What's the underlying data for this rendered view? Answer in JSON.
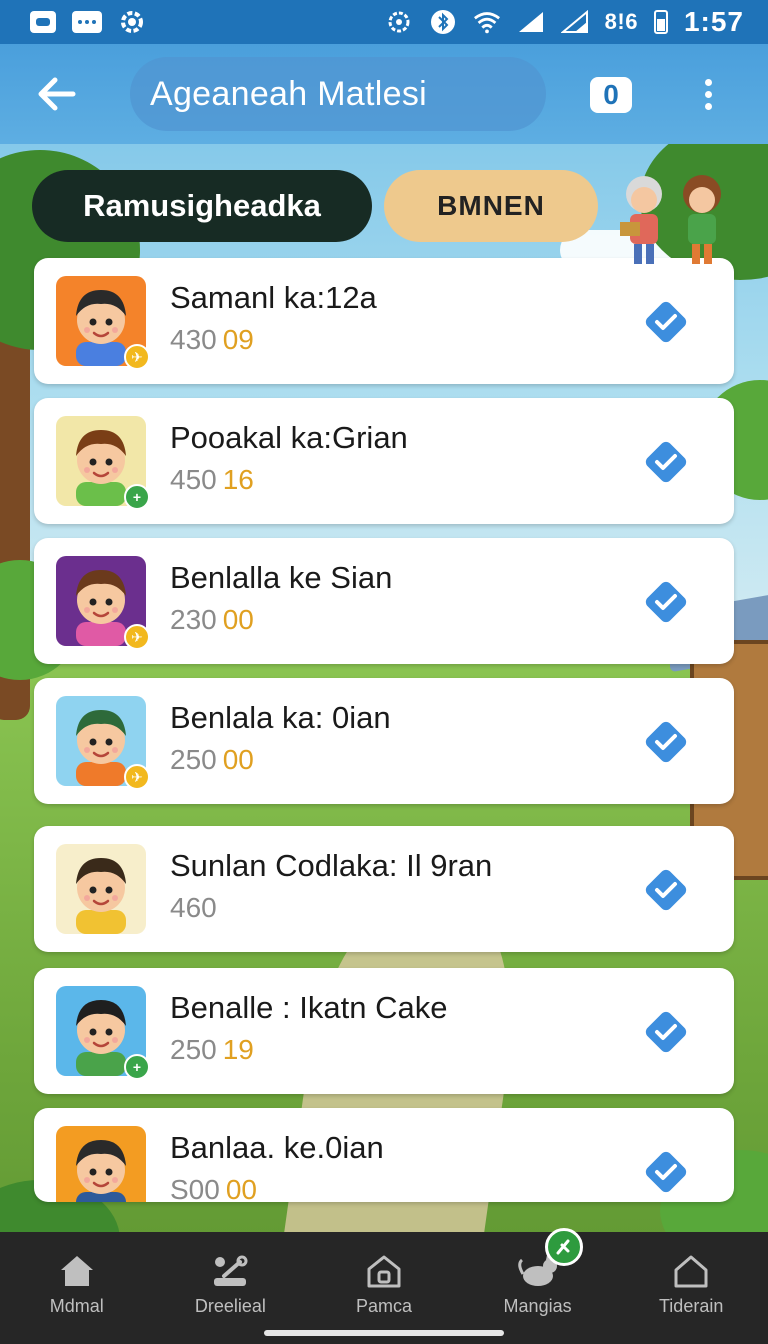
{
  "status_bar": {
    "signal_text": "8!6",
    "time": "1:57"
  },
  "app_bar": {
    "title": "Ageaneah Matlesi",
    "count": "0"
  },
  "chips": {
    "primary": "Ramusigheadka",
    "secondary": "BMNEN"
  },
  "list": {
    "items": [
      {
        "name": "Samanl ka:12a",
        "n1": "430",
        "n2": "09",
        "avatar_bg": "#f4832a",
        "badge": "yellow"
      },
      {
        "name": "Pooakal ka:Grian",
        "n1": "450",
        "n2": "16",
        "avatar_bg": "#f2e7a8",
        "badge": "green"
      },
      {
        "name": "Benlalla ke Sian",
        "n1": "230",
        "n2": "00",
        "avatar_bg": "#6b2f8e",
        "badge": "yellow"
      },
      {
        "name": "Benlala ka: 0ian",
        "n1": "250",
        "n2": "00",
        "avatar_bg": "#8fd3f0",
        "badge": "yellow"
      },
      {
        "name": "Sunlan Codlaka: Il 9ran",
        "n1": "460",
        "n2": "",
        "avatar_bg": "#f7eecb",
        "badge": "none"
      },
      {
        "name": "Benalle : Ikatn Cake",
        "n1": "250",
        "n2": "19",
        "avatar_bg": "#5bb7ea",
        "badge": "green"
      },
      {
        "name": "Banlaa. ke.0ian",
        "n1": "S00",
        "n2": "00",
        "avatar_bg": "#f39c22",
        "badge": "none"
      }
    ]
  },
  "bottom_nav": {
    "items": [
      {
        "label": "Mdmal",
        "icon": "home-icon"
      },
      {
        "label": "Dreelieal",
        "icon": "tools-icon"
      },
      {
        "label": "Pamca",
        "icon": "house-outline-icon"
      },
      {
        "label": "Mangias",
        "icon": "cat-icon"
      },
      {
        "label": "Tiderain",
        "icon": "house-outline-icon"
      }
    ]
  },
  "colors": {
    "status_bar": "#1f73b8",
    "app_bar": "#4a9fdc",
    "check": "#3d8ede",
    "accent_number": "#e0a021",
    "nav_bg": "#262626"
  }
}
